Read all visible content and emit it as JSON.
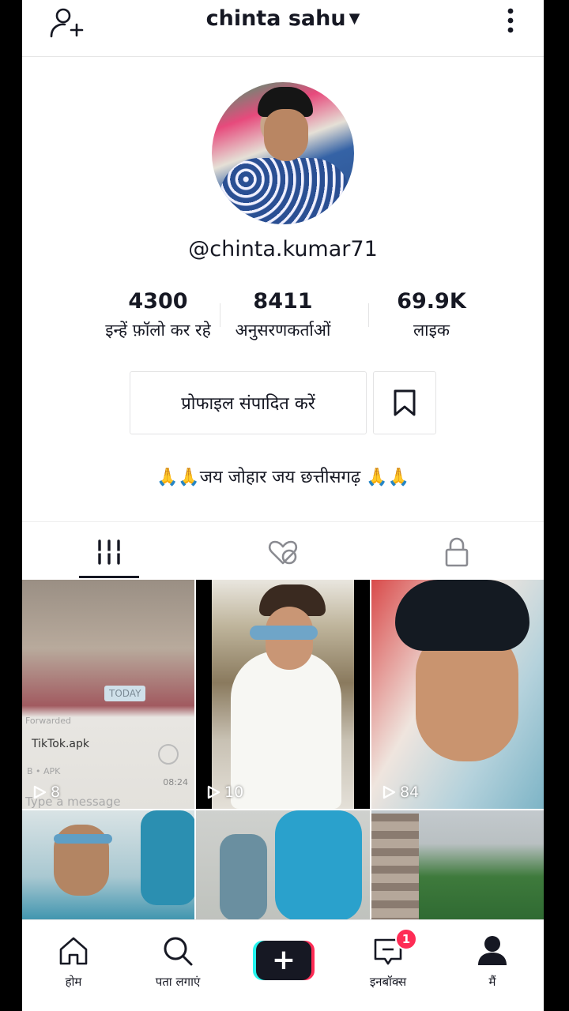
{
  "header": {
    "title": "chinta sahu"
  },
  "profile": {
    "handle": "@chinta.kumar71",
    "stats": [
      {
        "value": "4300",
        "label": "इन्हें फ़ॉलो कर रहे"
      },
      {
        "value": "8411",
        "label": "अनुसरणकर्ताओं"
      },
      {
        "value": "69.9K",
        "label": "लाइक"
      }
    ],
    "edit_label": "प्रोफाइल संपादित करें",
    "bio_emoji_left": "🙏🙏",
    "bio_text": "जय जोहार जय छत्तीसगढ़",
    "bio_emoji_right": "🙏🙏"
  },
  "videos": [
    {
      "views": "8",
      "chat": {
        "today": "TODAY",
        "forwarded": "Forwarded",
        "file": "TikTok.apk",
        "meta": "B • APK",
        "time": "08:24",
        "input": "Type a message"
      }
    },
    {
      "views": "10"
    },
    {
      "views": "84"
    }
  ],
  "nav": {
    "home": "होम",
    "discover": "पता लगाएं",
    "create": "+",
    "inbox": "इनबॉक्स",
    "inbox_badge": "1",
    "me": "मैं"
  },
  "colors": {
    "accent_pink": "#fe2c55",
    "accent_cyan": "#25f4ee",
    "text": "#161823"
  }
}
